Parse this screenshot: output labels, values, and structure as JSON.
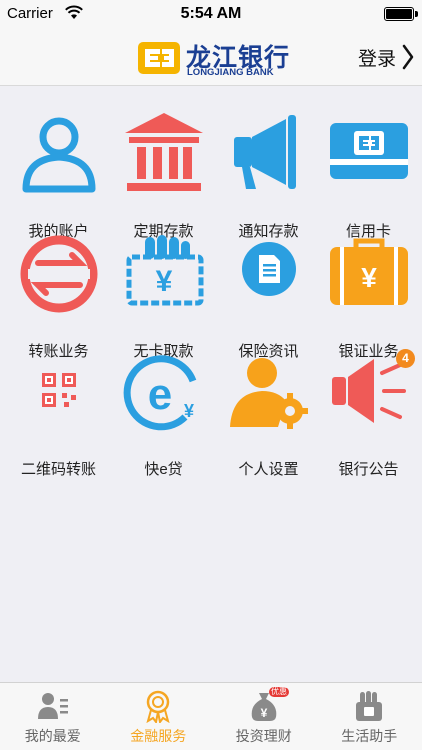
{
  "status_bar": {
    "carrier": "Carrier",
    "time": "5:54 AM"
  },
  "header": {
    "logo_cn": "龙江银行",
    "logo_en": "LONGJIANG BANK",
    "login_label": "登录",
    "brand_blue": "#1b3f93",
    "brand_yellow": "#f5b400"
  },
  "grid": {
    "items": [
      {
        "label": "我的账户",
        "icon": "user-account-icon"
      },
      {
        "label": "定期存款",
        "icon": "bank-building-icon"
      },
      {
        "label": "通知存款",
        "icon": "megaphone-icon"
      },
      {
        "label": "信用卡",
        "icon": "credit-card-icon"
      },
      {
        "label": "转账业务",
        "icon": "transfer-icon"
      },
      {
        "label": "无卡取款",
        "icon": "cardless-withdrawal-icon"
      },
      {
        "label": "保险资讯",
        "icon": "insurance-document-icon"
      },
      {
        "label": "银证业务",
        "icon": "briefcase-yuan-icon"
      },
      {
        "label": "二维码转账",
        "icon": "qr-code-icon"
      },
      {
        "label": "快e贷",
        "icon": "e-loan-icon"
      },
      {
        "label": "个人设置",
        "icon": "person-gear-icon"
      },
      {
        "label": "银行公告",
        "icon": "announcement-speaker-icon",
        "badge": "4"
      }
    ]
  },
  "tabs": [
    {
      "label": "我的最爱",
      "icon": "favorites-icon",
      "active": false
    },
    {
      "label": "金融服务",
      "icon": "financial-service-medal-icon",
      "active": true
    },
    {
      "label": "投资理财",
      "icon": "investment-bag-icon",
      "active": false,
      "badge": "优惠"
    },
    {
      "label": "生活助手",
      "icon": "life-assistant-icon",
      "active": false
    }
  ],
  "colors": {
    "blue": "#2b9fe0",
    "red": "#ef5a57",
    "orange": "#f7a21b",
    "active_tab": "#f5a623"
  }
}
